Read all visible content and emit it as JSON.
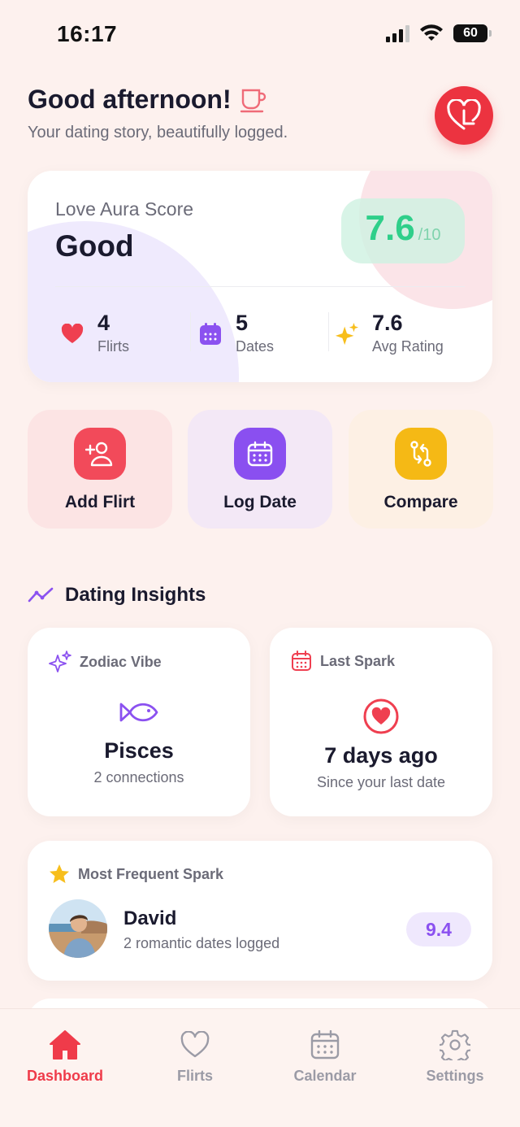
{
  "status_bar": {
    "time": "16:17",
    "battery": "60",
    "signal_icon": "cellular-signal-icon",
    "wifi_icon": "wifi-icon"
  },
  "header": {
    "greeting": "Good afternoon!",
    "greeting_icon": "coffee-cup-icon",
    "subtitle": "Your dating story, beautifully logged.",
    "logo_icon": "heart-logo-icon"
  },
  "aura": {
    "label": "Love Aura Score",
    "value": "Good",
    "score": "7.6",
    "score_max": "/10",
    "stats": [
      {
        "value": "4",
        "label": "Flirts",
        "icon": "heart-icon"
      },
      {
        "value": "5",
        "label": "Dates",
        "icon": "calendar-icon"
      },
      {
        "value": "7.6",
        "label": "Avg Rating",
        "icon": "sparkles-icon"
      }
    ]
  },
  "actions": [
    {
      "label": "Add Flirt",
      "icon": "add-user-icon",
      "color": "#f24a5a",
      "bg": "#fce4e4"
    },
    {
      "label": "Log Date",
      "icon": "calendar-icon",
      "color": "#8a4ff0",
      "bg": "#f3e8f6"
    },
    {
      "label": "Compare",
      "icon": "compare-icon",
      "color": "#f5b915",
      "bg": "#fdf0e4"
    }
  ],
  "insights": {
    "title": "Dating Insights",
    "title_icon": "trend-line-icon",
    "zodiac": {
      "label": "Zodiac Vibe",
      "icon": "sparkles-icon",
      "value": "Pisces",
      "sub": "2 connections",
      "value_icon": "fish-icon"
    },
    "last_spark": {
      "label": "Last Spark",
      "icon": "calendar-icon",
      "value": "7 days ago",
      "sub": "Since your last date",
      "value_icon": "heart-circle-icon"
    }
  },
  "frequent_spark": {
    "label": "Most Frequent Spark",
    "icon": "star-icon",
    "name": "David",
    "sub": "2 romantic dates logged",
    "score": "9.4"
  },
  "tabs": [
    {
      "label": "Dashboard",
      "icon": "home-icon",
      "active": true
    },
    {
      "label": "Flirts",
      "icon": "heart-outline-icon",
      "active": false
    },
    {
      "label": "Calendar",
      "icon": "calendar-outline-icon",
      "active": false
    },
    {
      "label": "Settings",
      "icon": "gear-icon",
      "active": false
    }
  ],
  "colors": {
    "accent": "#ec3340",
    "purple": "#8b51f0",
    "green": "#2fcf8a",
    "background": "#fdf1ee"
  }
}
